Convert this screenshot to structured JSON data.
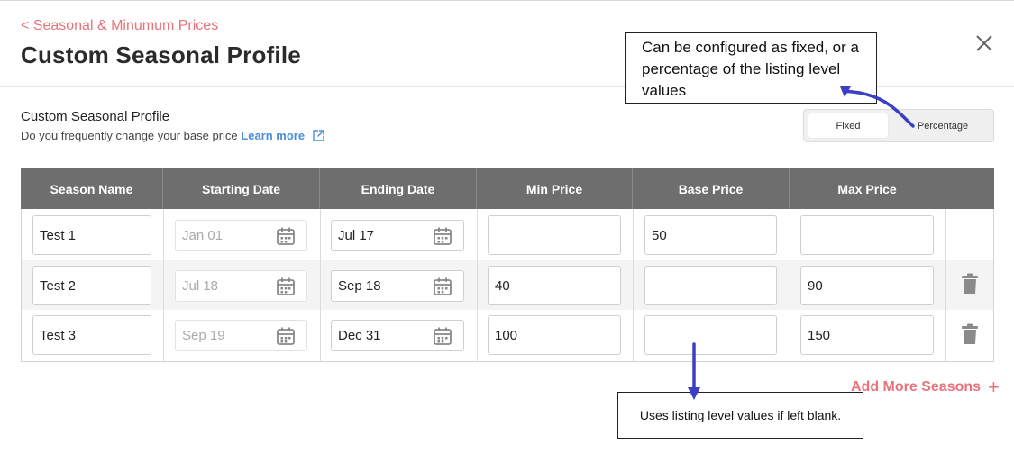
{
  "header": {
    "back_link": "< Seasonal & Minumum Prices",
    "title": "Custom Seasonal Profile",
    "close_icon": "close-icon"
  },
  "section": {
    "title": "Custom Seasonal Profile",
    "subtitle": "Do you frequently change your base price",
    "learn_more": "Learn more",
    "learn_more_icon": "external-link-icon"
  },
  "toggle": {
    "options": [
      "Fixed",
      "Percentage"
    ],
    "selected": "Fixed"
  },
  "table": {
    "columns": [
      "Season Name",
      "Starting Date",
      "Ending Date",
      "Min Price",
      "Base Price",
      "Max Price",
      ""
    ],
    "rows": [
      {
        "season": "Test 1",
        "start": "Jan 01",
        "end": "Jul 17",
        "min": "",
        "base": "50",
        "max": "",
        "deletable": false
      },
      {
        "season": "Test 2",
        "start": "Jul 18",
        "end": "Sep 18",
        "min": "40",
        "base": "",
        "max": "90",
        "deletable": true
      },
      {
        "season": "Test 3",
        "start": "Sep 19",
        "end": "Dec 31",
        "min": "100",
        "base": "",
        "max": "150",
        "deletable": true
      }
    ]
  },
  "add_more": {
    "label": "Add More Seasons",
    "icon": "plus-icon"
  },
  "annotations": {
    "toggle_note": "Can be configured as fixed, or a percentage of the listing level values",
    "base_price_note": "Uses listing level values if left blank.",
    "arrow_color": "#3b3fc4"
  },
  "colors": {
    "accent": "#e8737a",
    "link": "#4a8fd8",
    "table_header": "#6e6e6e"
  }
}
